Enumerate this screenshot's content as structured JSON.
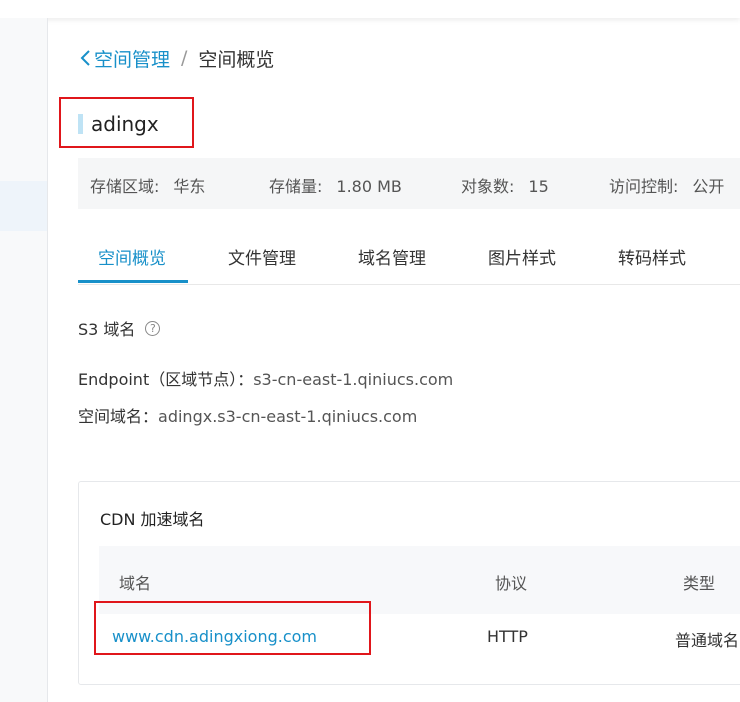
{
  "breadcrumb": {
    "back_label": "空间管理",
    "separator": "/",
    "current": "空间概览"
  },
  "bucket": {
    "name": "adingx"
  },
  "stats": [
    {
      "label": "存储区域:",
      "value": "华东"
    },
    {
      "label": "存储量:",
      "value": "1.80 MB"
    },
    {
      "label": "对象数:",
      "value": "15"
    },
    {
      "label": "访问控制:",
      "value": "公开"
    }
  ],
  "tabs": [
    {
      "label": "空间概览",
      "active": true
    },
    {
      "label": "文件管理",
      "active": false
    },
    {
      "label": "域名管理",
      "active": false
    },
    {
      "label": "图片样式",
      "active": false
    },
    {
      "label": "转码样式",
      "active": false
    }
  ],
  "s3": {
    "title": "S3 域名",
    "help_icon": "?",
    "endpoint_label": "Endpoint（区域节点）：",
    "endpoint_value": "s3-cn-east-1.qiniucs.com",
    "bucket_domain_label": "空间域名：",
    "bucket_domain_value": "adingx.s3-cn-east-1.qiniucs.com"
  },
  "cdn": {
    "title": "CDN 加速域名",
    "columns": [
      "域名",
      "协议",
      "类型"
    ],
    "rows": [
      {
        "domain": "www.cdn.adingxiong.com",
        "protocol": "HTTP",
        "type": "普通域名"
      }
    ]
  },
  "colors": {
    "accent": "#1890c9",
    "highlight_box": "#e0161b"
  }
}
